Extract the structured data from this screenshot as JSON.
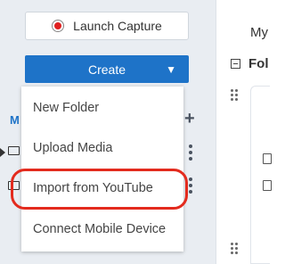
{
  "sidebar": {
    "launch_label": "Launch Capture",
    "create_label": "Create",
    "section_initial": "M"
  },
  "create_menu": {
    "items": [
      {
        "label": "New Folder"
      },
      {
        "label": "Upload Media"
      },
      {
        "label": "Import from YouTube",
        "highlighted": true
      },
      {
        "label": "Connect Mobile Device"
      }
    ]
  },
  "main": {
    "title_partial": "My",
    "folder_partial": "Fol"
  },
  "colors": {
    "accent": "#1e73c8",
    "highlight": "#e32b1e",
    "record": "#e02020"
  }
}
